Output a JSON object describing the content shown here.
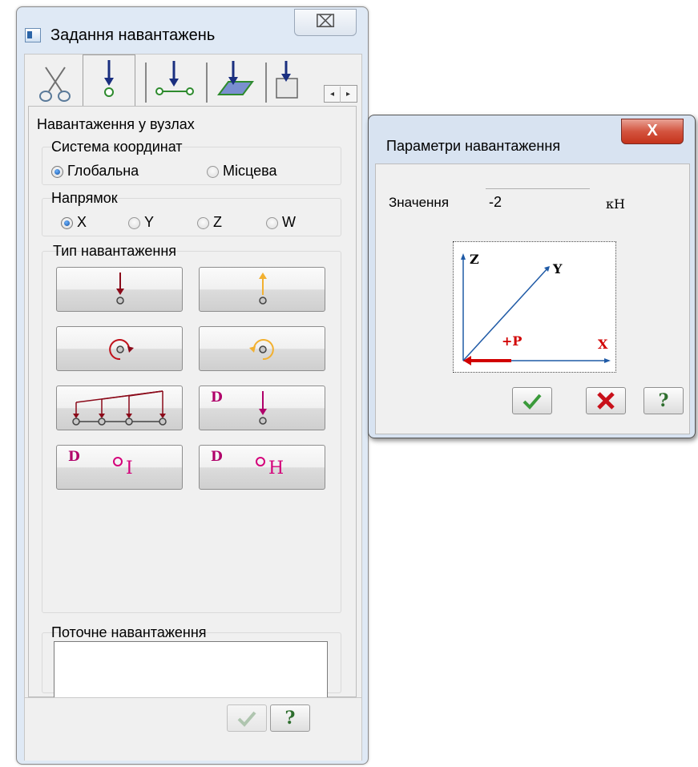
{
  "main_window": {
    "title": "Задання навантажень",
    "close_glyph": "⌧",
    "tabs": [
      "scissors-icon",
      "node-load-icon",
      "bar-load-icon",
      "plate-load-icon",
      "solid-load-icon"
    ],
    "section_title": "Навантаження у вузлах",
    "coord_system": {
      "label": "Система координат",
      "options": [
        "Глобальна",
        "Місцева"
      ],
      "selected": "Глобальна"
    },
    "direction": {
      "label": "Напрямок",
      "options": [
        "X",
        "Y",
        "Z",
        "W"
      ],
      "selected": "X"
    },
    "load_type": {
      "label": "Тип навантаження",
      "buttons": [
        "concentrated-force-down-icon",
        "concentrated-force-up-icon",
        "moment-clockwise-icon",
        "moment-counterclockwise-icon",
        "distributed-nodes-icon",
        "dynamic-force-icon",
        "dynamic-mass-i-icon",
        "dynamic-mass-h-icon"
      ],
      "letters": {
        "d": "D",
        "i": "I",
        "h": "H"
      }
    },
    "current_load_label": "Поточне навантаження",
    "current_load_value": "",
    "footer": {
      "apply_icon": "checkmark-icon",
      "help_label": "?"
    }
  },
  "params_window": {
    "title": "Параметри навантаження",
    "close_glyph": "X",
    "value_label": "Значення",
    "value": "-2",
    "unit": "кН",
    "diagram": {
      "z": "Z",
      "y": "Y",
      "x": "X",
      "p": "+P"
    },
    "help_label": "?"
  },
  "colors": {
    "load_arrow": "#8b0a1a",
    "moment_orange": "#f2b030",
    "accent_blue": "#1f5aa6",
    "force_red": "#d10000",
    "magenta": "#b0006a"
  }
}
